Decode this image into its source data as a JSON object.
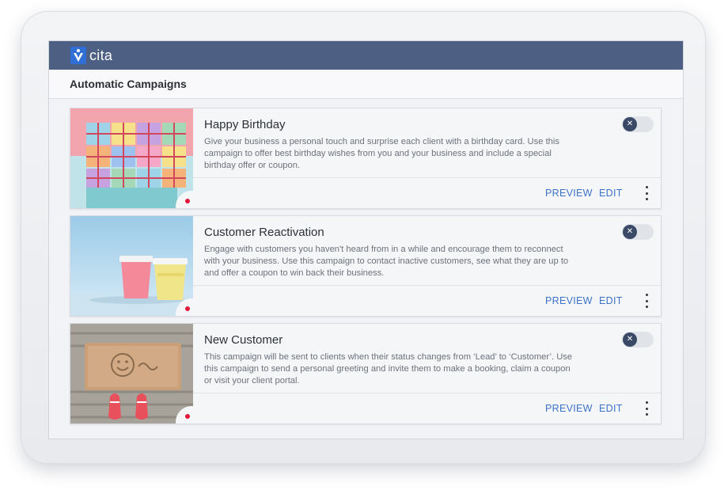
{
  "app": {
    "logo_text": "cita"
  },
  "header": {
    "title": "Automatic Campaigns"
  },
  "campaigns": [
    {
      "title": "Happy Birthday",
      "description": "Give your business a personal touch and surprise each client with a birthday card. Use this campaign to offer best birthday wishes from you and your business and include a special birthday offer or coupon.",
      "preview_label": "PREVIEW",
      "edit_label": "EDIT",
      "image": "gift-boxes"
    },
    {
      "title": "Customer Reactivation",
      "description": "Engage with customers you haven't heard from in a while and encourage them to reconnect with your business. Use this campaign to contact inactive customers, see what they are up to and offer a coupon to win back their business.",
      "preview_label": "PREVIEW",
      "edit_label": "EDIT",
      "image": "coffee-cups"
    },
    {
      "title": "New Customer",
      "description": "This campaign will be sent to clients when their status changes from ‘Lead’ to ‘Customer’. Use this campaign to send a personal greeting and invite them to make a booking, claim a coupon or visit your client portal.",
      "preview_label": "PREVIEW",
      "edit_label": "EDIT",
      "image": "doormat-sneakers"
    }
  ],
  "colors": {
    "topbar": "#4d5f82",
    "accent": "#3c72c8",
    "indicator": "#e3173b"
  }
}
